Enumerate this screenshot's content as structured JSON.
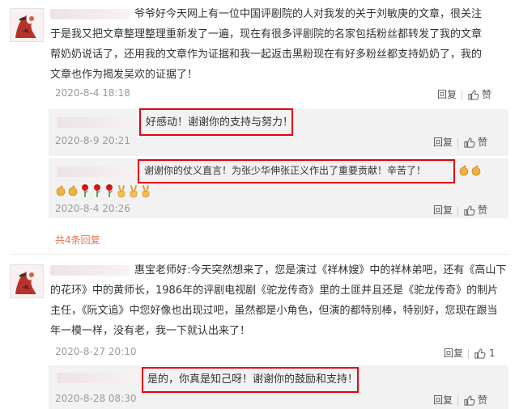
{
  "comments": [
    {
      "text": "爷爷好今天网上有一位中国评剧院的人对我发的关于刘敏庚的文章，很关注于是我又把文章整理整理重新发了一遍，现在有很多评剧院的名家包括粉丝都转发了我的文章帮奶奶说话了，还用我的文章作为证据和我一起返击黑粉现在有好多粉丝都支持奶奶了，我的文章也作为揭发吴欢的证据了！",
      "date": "2020-8-4 18:18",
      "reply_label": "回复",
      "like_label": "赞",
      "replies": [
        {
          "text": "好感动！谢谢你的支持与努力！",
          "date": "2020-8-9 20:21",
          "reply_label": "回复",
          "like_label": "赞"
        },
        {
          "text": "谢谢你的仗义直言！为张少华伸张正义作出了重要贡献！辛苦了！",
          "date": "2020-8-4 20:26",
          "reply_label": "回复",
          "like_label": "赞"
        }
      ],
      "more_replies": "共4条回复"
    },
    {
      "text": "惠宝老师好:今天突然想来了，您是演过《祥林嫂》中的祥林弟吧，还有《高山下的花环》中的黄师长，1986年的评剧电视剧《驼龙传奇》里的土匪并且还是《驼龙传奇》的制片主任，《阮文追》中您好像也出现过吧，虽然都是小角色，但演的都特别棒，特别好，您现在跟当年一模一样，没有老，我一下就认出来了！",
      "date": "2020-8-27 20:10",
      "reply_label": "回复",
      "like_count": "1",
      "replies": [
        {
          "text": "是的，你真是知己呀！谢谢你的鼓励和支持！",
          "date": "2020-8-28 08:30",
          "reply_label": "回复",
          "like_label": "赞"
        }
      ]
    }
  ],
  "colors": {
    "highlight_border": "#e60012",
    "more_link": "#eb7350",
    "reply_bg": "#f2f2f2"
  },
  "icons": [
    "avatar",
    "thumbs-up-icon",
    "rose-icon",
    "clap-icon",
    "victory-hand-icon"
  ]
}
